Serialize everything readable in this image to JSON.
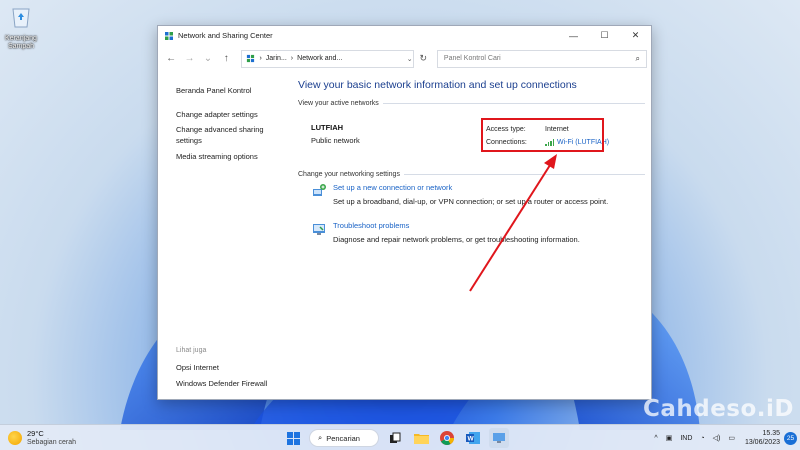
{
  "desktop": {
    "recycle_bin_label": "Keranjang Sampah"
  },
  "window": {
    "title": "Network and Sharing Center",
    "controls": {
      "minimize": "—",
      "maximize": "☐",
      "close": "✕"
    }
  },
  "address_bar": {
    "back": "←",
    "forward": "→",
    "recent": "⌄",
    "up": "↑",
    "crumbs": [
      "Jarin...",
      "›",
      "Network and..."
    ],
    "dropdown": "⌄",
    "refresh": "↻",
    "search_placeholder": "Panel Kontrol Cari"
  },
  "sidebar": {
    "home": "Beranda Panel Kontrol",
    "links": [
      "Change adapter settings",
      "Change advanced sharing",
      "settings",
      "Media streaming options"
    ],
    "see_also_heading": "Lihat juga",
    "see_also": [
      "Opsi Internet",
      "Windows Defender Firewall"
    ]
  },
  "main": {
    "title": "View your basic network information and set up connections",
    "active_networks_heading": "View your active networks",
    "network_name": "LUTFIAH",
    "network_type": "Public network",
    "access_type_label": "Access type:",
    "access_type_value": "Internet",
    "connections_label": "Connections:",
    "connections_value": "Wi-Fi (LUTFIAH)",
    "change_settings_heading": "Change your networking settings",
    "tasks": [
      {
        "link": "Set up a new connection or network",
        "desc": "Set up a broadband, dial-up, or VPN connection; or set up a router or access point."
      },
      {
        "link": "Troubleshoot problems",
        "desc": "Diagnose and repair network problems, or get troubleshooting information."
      }
    ]
  },
  "watermark": "Cahdeso.iD",
  "taskbar": {
    "weather_temp": "29°C",
    "weather_desc": "Sebagian cerah",
    "search_label": "Pencarian",
    "language": "IND",
    "time": "15.35",
    "date": "13/06/2023",
    "notification_count": "25",
    "tray_chevron": "^"
  },
  "colors": {
    "link": "#1a63c6",
    "title": "#1b3f8f",
    "highlight": "#e0161c"
  }
}
